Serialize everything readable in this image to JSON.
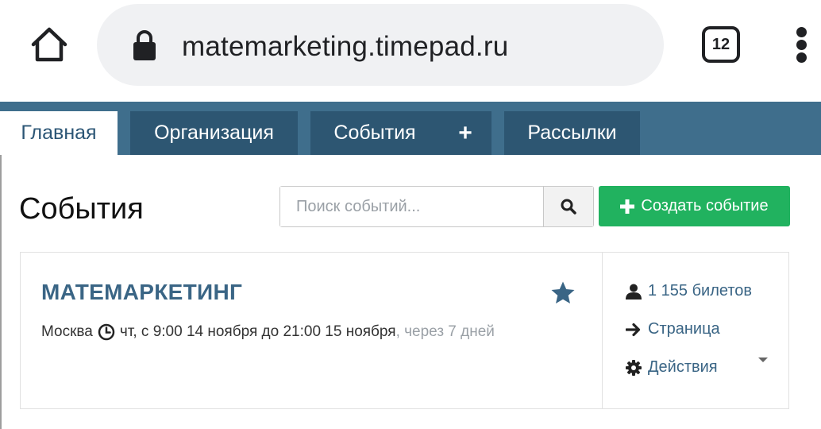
{
  "browser": {
    "url": "matemarketing.timepad.ru",
    "tab_count": "12"
  },
  "nav": {
    "items": [
      {
        "label": "Главная",
        "active": true
      },
      {
        "label": "Организация",
        "active": false
      },
      {
        "label": "События",
        "active": false
      },
      {
        "label": "+",
        "active": false
      },
      {
        "label": "Рассылки",
        "active": false
      }
    ]
  },
  "page": {
    "title": "События",
    "search_placeholder": "Поиск событий...",
    "create_label": "Создать событие"
  },
  "event": {
    "title": "МАТЕМАРКЕТИНГ",
    "city": "Москва",
    "time": "чт, с 9:00 14 ноября до 21:00 15 ноября",
    "relative": ", через 7 дней",
    "tickets": "1 155 билетов",
    "page_link": "Страница",
    "actions": "Действия"
  },
  "colors": {
    "nav_bg": "#3f6e8c",
    "nav_item_bg": "#2d5672",
    "accent_green": "#21b25f",
    "link_blue": "#3a6585"
  },
  "icons": [
    "home-icon",
    "lock-icon",
    "tabs-counter",
    "more-vert-icon",
    "search-icon",
    "plus-icon",
    "star-icon",
    "clock-icon",
    "user-icon",
    "arrow-right-icon",
    "gear-icon",
    "caret-down-icon"
  ]
}
